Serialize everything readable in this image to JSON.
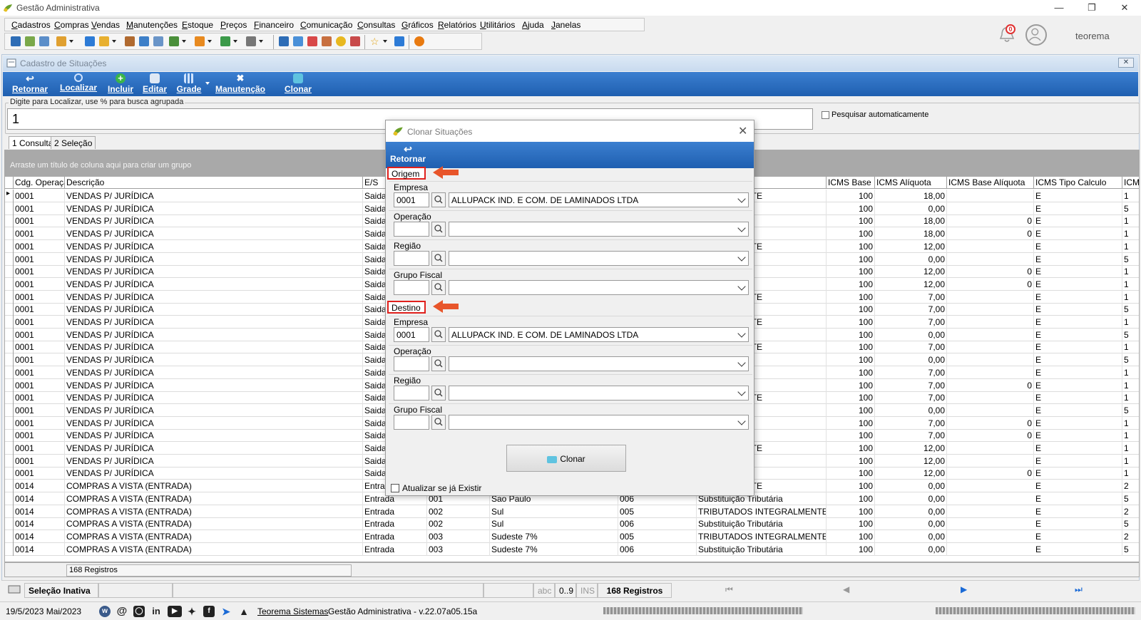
{
  "app": {
    "title": "Gestão Administrativa",
    "username": "teorema",
    "notifications": "0"
  },
  "menu": [
    "Cadastros",
    "Compras",
    "Vendas",
    "Manutenções",
    "Estoque",
    "Preços",
    "Financeiro",
    "Comunicação",
    "Consultas",
    "Gráficos",
    "Relatórios",
    "Utilitários",
    "Ajuda",
    "Janelas"
  ],
  "child": {
    "title": "Cadastro de Situações",
    "ribbon": [
      "Retornar",
      "Localizar",
      "Incluir",
      "Editar",
      "Grade",
      "Manutenção",
      "Clonar"
    ],
    "search_label": "Digite para Localizar, use % para busca agrupada",
    "search_value": "1",
    "auto_search_label": "Pesquisar automaticamente",
    "tabs": [
      "1 Consulta",
      "2 Seleção"
    ],
    "group_hint": "Arraste um título de coluna aqui para criar um grupo",
    "footer_count": "168 Registros"
  },
  "grid": {
    "columns_left": [
      "Cdg. Operação",
      "Descrição",
      "E/S"
    ],
    "columns_right": [
      "ICMS Base",
      "ICMS Alíquota",
      "ICMS Base Alíquota",
      "ICMS Tipo Calculo",
      "ICMS"
    ],
    "rows_vendas": [
      {
        "c": "0001",
        "d": "VENDAS P/ JURÍDICA",
        "es": "Saida",
        "sit": "TEGRALMENTE",
        "base": "100",
        "aliq": "18,00",
        "ba": "",
        "tipo": "E",
        "icms": "1"
      },
      {
        "c": "0001",
        "d": "VENDAS P/ JURÍDICA",
        "es": "Saida",
        "sit": "tária",
        "base": "100",
        "aliq": "0,00",
        "ba": "",
        "tipo": "E",
        "icms": "5"
      },
      {
        "c": "0001",
        "d": "VENDAS P/ JURÍDICA",
        "es": "Saida",
        "sit": "IPI",
        "base": "100",
        "aliq": "18,00",
        "ba": "0",
        "tipo": "E",
        "icms": "1"
      },
      {
        "c": "0001",
        "d": "VENDAS P/ JURÍDICA",
        "es": "Saida",
        "sit": "",
        "base": "100",
        "aliq": "18,00",
        "ba": "0",
        "tipo": "E",
        "icms": "1"
      },
      {
        "c": "0001",
        "d": "VENDAS P/ JURÍDICA",
        "es": "Saida",
        "sit": "TEGRALMENTE",
        "base": "100",
        "aliq": "12,00",
        "ba": "",
        "tipo": "E",
        "icms": "1"
      },
      {
        "c": "0001",
        "d": "VENDAS P/ JURÍDICA",
        "es": "Saida",
        "sit": "tária",
        "base": "100",
        "aliq": "0,00",
        "ba": "",
        "tipo": "E",
        "icms": "5"
      },
      {
        "c": "0001",
        "d": "VENDAS P/ JURÍDICA",
        "es": "Saida",
        "sit": "IPI",
        "base": "100",
        "aliq": "12,00",
        "ba": "0",
        "tipo": "E",
        "icms": "1"
      },
      {
        "c": "0001",
        "d": "VENDAS P/ JURÍDICA",
        "es": "Saida",
        "sit": "",
        "base": "100",
        "aliq": "12,00",
        "ba": "0",
        "tipo": "E",
        "icms": "1"
      },
      {
        "c": "0001",
        "d": "VENDAS P/ JURÍDICA",
        "es": "Saida",
        "sit": "TEGRALMENTE",
        "base": "100",
        "aliq": "7,00",
        "ba": "",
        "tipo": "E",
        "icms": "1"
      },
      {
        "c": "0001",
        "d": "VENDAS P/ JURÍDICA",
        "es": "Saida",
        "sit": "tária",
        "base": "100",
        "aliq": "7,00",
        "ba": "",
        "tipo": "E",
        "icms": "5"
      },
      {
        "c": "0001",
        "d": "VENDAS P/ JURÍDICA",
        "es": "Saida",
        "sit": "TEGRALMENTE",
        "base": "100",
        "aliq": "7,00",
        "ba": "",
        "tipo": "E",
        "icms": "1"
      },
      {
        "c": "0001",
        "d": "VENDAS P/ JURÍDICA",
        "es": "Saida",
        "sit": "tária",
        "base": "100",
        "aliq": "0,00",
        "ba": "",
        "tipo": "E",
        "icms": "5"
      },
      {
        "c": "0001",
        "d": "VENDAS P/ JURÍDICA",
        "es": "Saida",
        "sit": "TEGRALMENTE",
        "base": "100",
        "aliq": "7,00",
        "ba": "",
        "tipo": "E",
        "icms": "1"
      },
      {
        "c": "0001",
        "d": "VENDAS P/ JURÍDICA",
        "es": "Saida",
        "sit": "tária",
        "base": "100",
        "aliq": "0,00",
        "ba": "",
        "tipo": "E",
        "icms": "5"
      },
      {
        "c": "0001",
        "d": "VENDAS P/ JURÍDICA",
        "es": "Saida",
        "sit": "IPI",
        "base": "100",
        "aliq": "7,00",
        "ba": "",
        "tipo": "E",
        "icms": "1"
      },
      {
        "c": "0001",
        "d": "VENDAS P/ JURÍDICA",
        "es": "Saida",
        "sit": "",
        "base": "100",
        "aliq": "7,00",
        "ba": "0",
        "tipo": "E",
        "icms": "1"
      },
      {
        "c": "0001",
        "d": "VENDAS P/ JURÍDICA",
        "es": "Saida",
        "sit": "TEGRALMENTE",
        "base": "100",
        "aliq": "7,00",
        "ba": "",
        "tipo": "E",
        "icms": "1"
      },
      {
        "c": "0001",
        "d": "VENDAS P/ JURÍDICA",
        "es": "Saida",
        "sit": "tária",
        "base": "100",
        "aliq": "0,00",
        "ba": "",
        "tipo": "E",
        "icms": "5"
      },
      {
        "c": "0001",
        "d": "VENDAS P/ JURÍDICA",
        "es": "Saida",
        "sit": "IPI",
        "base": "100",
        "aliq": "7,00",
        "ba": "0",
        "tipo": "E",
        "icms": "1"
      },
      {
        "c": "0001",
        "d": "VENDAS P/ JURÍDICA",
        "es": "Saida",
        "sit": "",
        "base": "100",
        "aliq": "7,00",
        "ba": "0",
        "tipo": "E",
        "icms": "1"
      },
      {
        "c": "0001",
        "d": "VENDAS P/ JURÍDICA",
        "es": "Saida",
        "sit": "TEGRALMENTE",
        "base": "100",
        "aliq": "12,00",
        "ba": "",
        "tipo": "E",
        "icms": "1"
      },
      {
        "c": "0001",
        "d": "VENDAS P/ JURÍDICA",
        "es": "Saida",
        "sit": "IPI",
        "base": "100",
        "aliq": "12,00",
        "ba": "",
        "tipo": "E",
        "icms": "1"
      },
      {
        "c": "0001",
        "d": "VENDAS P/ JURÍDICA",
        "es": "Saida",
        "sit": "",
        "base": "100",
        "aliq": "12,00",
        "ba": "0",
        "tipo": "E",
        "icms": "1"
      }
    ],
    "rows_compras": [
      {
        "c": "0014",
        "d": "COMPRAS A VISTA (ENTRADA)",
        "es": "Entrada",
        "r": "",
        "rn": "",
        "g": "",
        "sit": "TEGRALMENTE",
        "base": "100",
        "aliq": "0,00",
        "tipo": "E",
        "icms": "2"
      },
      {
        "c": "0014",
        "d": "COMPRAS A VISTA (ENTRADA)",
        "es": "Entrada",
        "r": "001",
        "rn": "Sao Paulo",
        "g": "006",
        "sit": "Substituição Tributária",
        "base": "100",
        "aliq": "0,00",
        "tipo": "E",
        "icms": "5"
      },
      {
        "c": "0014",
        "d": "COMPRAS A VISTA (ENTRADA)",
        "es": "Entrada",
        "r": "002",
        "rn": "Sul",
        "g": "005",
        "sit": "TRIBUTADOS INTEGRALMENTE",
        "base": "100",
        "aliq": "0,00",
        "tipo": "E",
        "icms": "2"
      },
      {
        "c": "0014",
        "d": "COMPRAS A VISTA (ENTRADA)",
        "es": "Entrada",
        "r": "002",
        "rn": "Sul",
        "g": "006",
        "sit": "Substituição Tributária",
        "base": "100",
        "aliq": "0,00",
        "tipo": "E",
        "icms": "5"
      },
      {
        "c": "0014",
        "d": "COMPRAS A VISTA (ENTRADA)",
        "es": "Entrada",
        "r": "003",
        "rn": "Sudeste 7%",
        "g": "005",
        "sit": "TRIBUTADOS INTEGRALMENTE",
        "base": "100",
        "aliq": "0,00",
        "tipo": "E",
        "icms": "2"
      },
      {
        "c": "0014",
        "d": "COMPRAS A VISTA (ENTRADA)",
        "es": "Entrada",
        "r": "003",
        "rn": "Sudeste 7%",
        "g": "006",
        "sit": "Substituição Tributária",
        "base": "100",
        "aliq": "0,00",
        "tipo": "E",
        "icms": "5"
      }
    ]
  },
  "dialog": {
    "title": "Clonar Situações",
    "back": "Retornar",
    "origem": "Origem",
    "destino": "Destino",
    "labels": [
      "Empresa",
      "Operação",
      "Região",
      "Grupo Fiscal"
    ],
    "origem_empresa_code": "0001",
    "origem_empresa_name": "ALLUPACK IND. E COM. DE LAMINADOS LTDA",
    "destino_empresa_code": "0001",
    "destino_empresa_name": "ALLUPACK IND. E COM. DE LAMINADOS LTDA",
    "clonar_label": "Clonar",
    "atualizar_label": "Atualizar se já Existir"
  },
  "statusbar": {
    "selection": "Seleção Inativa",
    "abc": "abc",
    "range": "0..9",
    "ins": "INS",
    "records": "168 Registros"
  },
  "bottombar": {
    "date": "19/5/2023 Mai/2023",
    "company": "Teorema Sistemas",
    "version": "Gestão Administrativa - v.22.07a05.15a"
  }
}
